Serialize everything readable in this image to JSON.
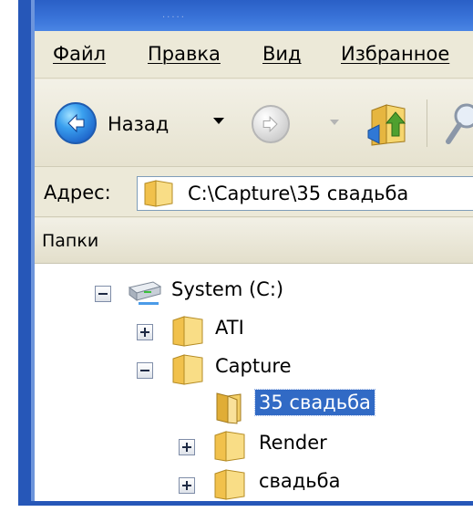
{
  "window": {
    "menu": [
      {
        "label": "Файл"
      },
      {
        "label": "Правка"
      },
      {
        "label": "Вид"
      },
      {
        "label": "Избранное"
      }
    ],
    "toolbar": {
      "back_label": "Назад",
      "back_icon": "back-arrow-icon",
      "forward_icon": "forward-arrow-icon",
      "up_icon": "folder-up-icon",
      "search_icon": "search-icon"
    },
    "address": {
      "label": "Адрес:",
      "value": "C:\\Capture\\35 свадьба"
    },
    "folders_pane": {
      "title": "Папки",
      "tree": [
        {
          "label": "System (C:)",
          "icon": "drive-icon",
          "expander": "minus"
        },
        {
          "label": "ATI",
          "icon": "folder-icon",
          "expander": "plus"
        },
        {
          "label": "Capture",
          "icon": "folder-icon",
          "expander": "minus"
        },
        {
          "label": "35 свадьба",
          "icon": "open-folder-icon",
          "expander": "none",
          "selected": true
        },
        {
          "label": "Render",
          "icon": "folder-icon",
          "expander": "plus"
        },
        {
          "label": "свадьба",
          "icon": "folder-icon",
          "expander": "plus"
        }
      ]
    }
  },
  "colors": {
    "frame_blue": "#2657b8",
    "chrome": "#ece9d8",
    "selection": "#316ac5",
    "folder_yellow": "#f6d66e"
  }
}
